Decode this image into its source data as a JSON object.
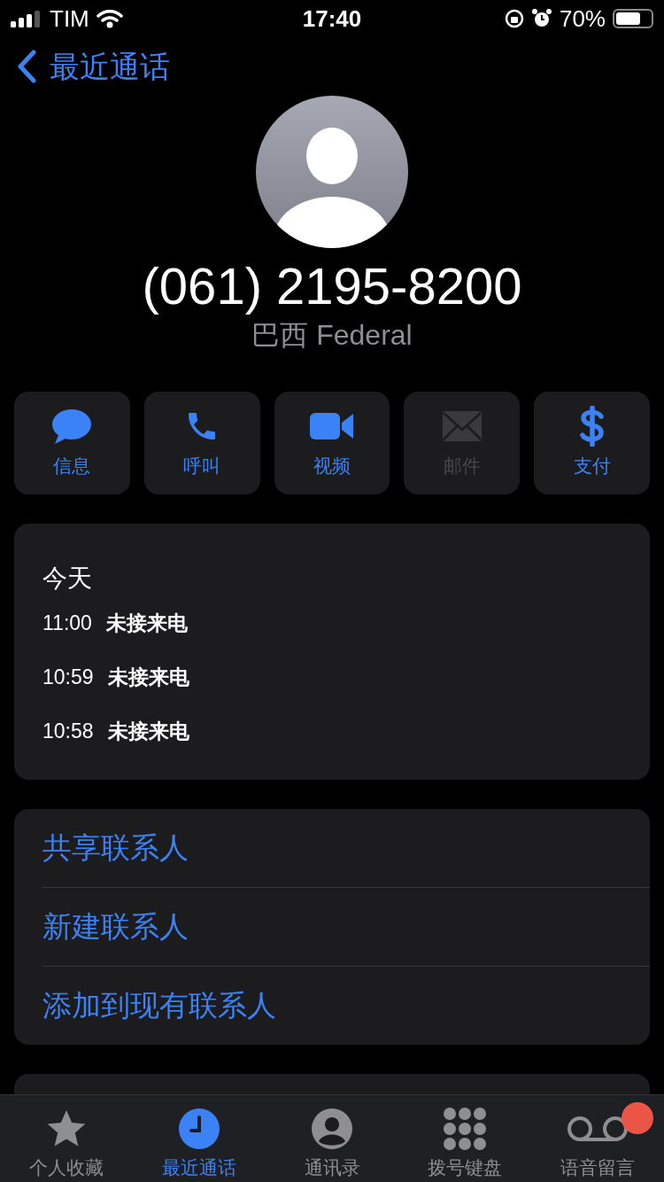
{
  "status_bar": {
    "carrier": "TIM",
    "time": "17:40",
    "battery": "70%"
  },
  "nav": {
    "back": "最近通话"
  },
  "contact": {
    "number": "(061) 2195-8200",
    "location": "巴西 Federal"
  },
  "actions": [
    {
      "kind": "message",
      "label": "信息",
      "disabled": false
    },
    {
      "kind": "call",
      "label": "呼叫",
      "disabled": false
    },
    {
      "kind": "video",
      "label": "视频",
      "disabled": false
    },
    {
      "kind": "mail",
      "label": "邮件",
      "disabled": true
    },
    {
      "kind": "pay",
      "label": "支付",
      "disabled": false
    }
  ],
  "history": {
    "date": "今天",
    "calls": [
      {
        "time": "11:00",
        "type": "未接来电"
      },
      {
        "time": "10:59",
        "type": "未接来电"
      },
      {
        "time": "10:58",
        "type": "未接来电"
      }
    ]
  },
  "links": [
    "共享联系人",
    "新建联系人",
    "添加到现有联系人"
  ],
  "tabs": [
    {
      "kind": "favorites",
      "label": "个人收藏",
      "selected": false,
      "badge": false
    },
    {
      "kind": "recents",
      "label": "最近通话",
      "selected": true,
      "badge": false
    },
    {
      "kind": "contacts",
      "label": "通讯录",
      "selected": false,
      "badge": false
    },
    {
      "kind": "keypad",
      "label": "拨号键盘",
      "selected": false,
      "badge": false
    },
    {
      "kind": "voicemail",
      "label": "语音留言",
      "selected": false,
      "badge": true
    }
  ]
}
